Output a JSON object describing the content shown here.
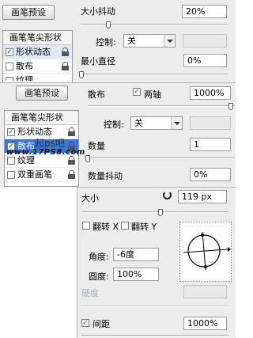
{
  "top": {
    "preset_button": "画笔预设",
    "tip_shape_header": "画笔笔尖形状",
    "items": [
      {
        "label": "形状动态",
        "checked": true
      },
      {
        "label": "散布",
        "checked": false
      },
      {
        "label": "纹理",
        "checked": false
      }
    ],
    "size_jitter_label": "大小抖动",
    "size_jitter_value": "20%",
    "control_label": "控制:",
    "control_value": "关",
    "min_diameter_label": "最小直径",
    "min_diameter_value": "0%"
  },
  "mid": {
    "preset_button": "画笔预设",
    "tip_shape_header": "画笔笔尖形状",
    "items": [
      {
        "label": "形状动态",
        "checked": true
      },
      {
        "label": "散布",
        "checked": true
      },
      {
        "label": "纹理",
        "checked": false
      },
      {
        "label": "双重画笔",
        "checked": false
      }
    ],
    "scatter_label": "散布",
    "both_axes_label": "两轴",
    "scatter_value": "1000%",
    "control_label": "控制:",
    "control_value": "关",
    "count_label": "数量",
    "count_value": "1",
    "count_jitter_label": "数量抖动",
    "count_jitter_value": "0%"
  },
  "watermark": {
    "line1": "起ps吧",
    "line2": "www.17PS8.com"
  },
  "bottom": {
    "size_label": "大小",
    "size_value": "119 px",
    "flip_x_label": "翻转 X",
    "flip_y_label": "翻转 Y",
    "angle_label": "角度:",
    "angle_value": "-6度",
    "roundness_label": "圆度:",
    "roundness_value": "100%",
    "hardness_label": "硬度",
    "spacing_label": "间距",
    "spacing_value": "1000%"
  },
  "colors": {
    "panel_bg": "#ececec",
    "selection": "#3875d7",
    "check": "#1a3f9a"
  },
  "icons": [
    "lock-icon",
    "reset-icon",
    "dropdown-arrow-icon",
    "checkbox-icon",
    "angle-roundness-widget"
  ]
}
